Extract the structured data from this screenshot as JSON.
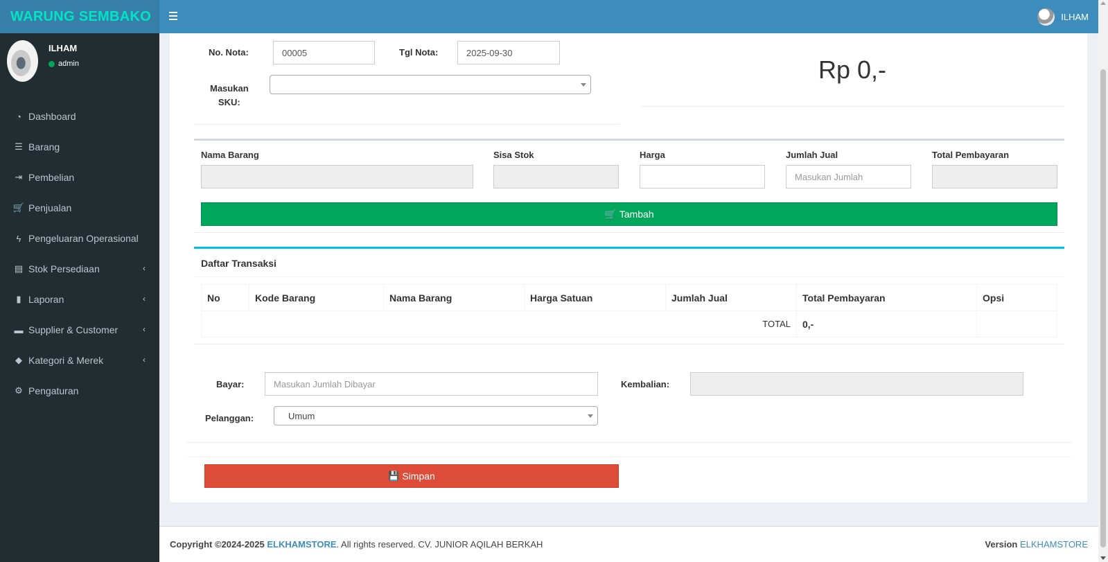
{
  "header": {
    "logo": "WARUNG SEMBAKO",
    "user_name": "ILHAM",
    "menu_toggle_icon": "hamburger-icon"
  },
  "sidebar": {
    "user_name": "ILHAM",
    "user_role": "admin",
    "status_color": "#00a65a",
    "items": [
      {
        "label": "Dashboard",
        "icon": "dashboard-icon",
        "glyph": "◔",
        "has_submenu": false
      },
      {
        "label": "Barang",
        "icon": "list-icon",
        "glyph": "☰",
        "has_submenu": false
      },
      {
        "label": "Pembelian",
        "icon": "sign-in-icon",
        "glyph": "⇥",
        "has_submenu": false
      },
      {
        "label": "Penjualan",
        "icon": "cart-icon",
        "glyph": "🛒",
        "has_submenu": false
      },
      {
        "label": "Pengeluaran Operasional",
        "icon": "bolt-icon",
        "glyph": "ϟ",
        "has_submenu": false
      },
      {
        "label": "Stok Persediaan",
        "icon": "inbox-icon",
        "glyph": "▤",
        "has_submenu": true
      },
      {
        "label": "Laporan",
        "icon": "bar-chart-icon",
        "glyph": "▮",
        "has_submenu": true
      },
      {
        "label": "Supplier & Customer",
        "icon": "building-icon",
        "glyph": "▬",
        "has_submenu": true
      },
      {
        "label": "Kategori & Merek",
        "icon": "tag-icon",
        "glyph": "◆",
        "has_submenu": true
      },
      {
        "label": "Pengaturan",
        "icon": "gear-icon",
        "glyph": "⚙",
        "has_submenu": false
      }
    ],
    "chevron": "‹"
  },
  "form": {
    "no_nota_label": "No. Nota:",
    "no_nota_value": "00005",
    "tgl_nota_label": "Tgl Nota:",
    "tgl_nota_value": "2025-09-30",
    "sku_label_line1": "Masukan",
    "sku_label_line2": "SKU:",
    "sku_value": ""
  },
  "total_display": "Rp 0,-",
  "item_entry": {
    "nama_barang_label": "Nama Barang",
    "sisa_stok_label": "Sisa Stok",
    "harga_label": "Harga",
    "jumlah_jual_label": "Jumlah Jual",
    "jumlah_jual_placeholder": "Masukan Jumlah",
    "total_pembayaran_label": "Total Pembayaran",
    "add_button": "Tambah",
    "add_button_icon": "cart-icon"
  },
  "transactions": {
    "title": "Daftar Transaksi",
    "columns": [
      "No",
      "Kode Barang",
      "Nama Barang",
      "Harga Satuan",
      "Jumlah Jual",
      "Total Pembayaran",
      "Opsi"
    ],
    "rows": [],
    "total_label": "TOTAL",
    "total_value": "0,-"
  },
  "payment": {
    "bayar_label": "Bayar:",
    "bayar_placeholder": "Masukan Jumlah Dibayar",
    "kembalian_label": "Kembalian:",
    "kembalian_value": "",
    "pelanggan_label": "Pelanggan:",
    "pelanggan_value": "Umum",
    "save_button": "Simpan",
    "save_button_icon": "save-icon"
  },
  "footer": {
    "copyright_prefix": "Copyright ©2024-2025",
    "brand": "ELKHAMSTORE",
    "rights": ". All rights reserved. CV. JUNIOR AQILAH BERKAH",
    "version_label": "Version",
    "version_value": "ELKHAMSTORE"
  },
  "colors": {
    "header": "#3c8dbc",
    "logo_bg": "#367fa9",
    "logo_text": "#00e5c3",
    "sidebar": "#222d32",
    "add_button": "#00a65a",
    "save_button": "#dd4b39",
    "trans_box_border": "#00c0ef"
  }
}
